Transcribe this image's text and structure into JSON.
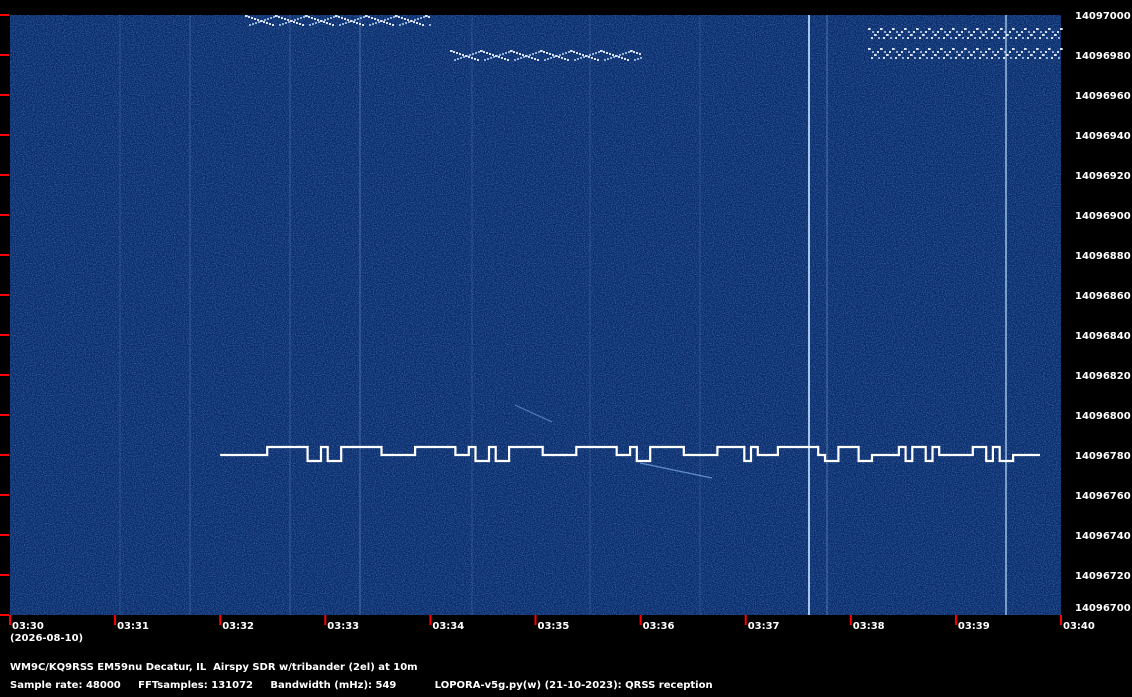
{
  "chart_data": {
    "type": "waterfall",
    "x": {
      "tick_labels": [
        "03:30",
        "03:31",
        "03:32",
        "03:33",
        "03:34",
        "03:35",
        "03:36",
        "03:37",
        "03:38",
        "03:39",
        "03:40"
      ],
      "date_label": "(2026-08-10)"
    },
    "y": {
      "range": [
        14096700,
        14097000
      ],
      "tick_labels": [
        "14097000",
        "14096980",
        "14096960",
        "14096940",
        "14096920",
        "14096900",
        "14096880",
        "14096860",
        "14096840",
        "14096820",
        "14096800",
        "14096780",
        "14096760",
        "14096740",
        "14096720",
        "14096700"
      ]
    },
    "signals": {
      "fsk_trace": {
        "start": "03:32",
        "end": "03:39.8",
        "base_freq": 14096780,
        "high_freq": 14096784,
        "low_freq": 14096777
      }
    }
  },
  "colors": {
    "background": "#000000",
    "plot_bg": "#0a2a6a",
    "tick_mark": "#ff0000",
    "trace": "#ffffff"
  },
  "footer": {
    "station": "WM9C/KQ9RSS EM59nu Decatur, IL  Airspy SDR w/tribander (2el) at 10m",
    "sample_rate": "Sample rate: 48000",
    "fft_samples": "FFTsamples: 131072",
    "bandwidth": "Bandwidth (mHz): 549",
    "software": "LOPORA-v5g.py(w) (21-10-2023): QRSS reception"
  }
}
